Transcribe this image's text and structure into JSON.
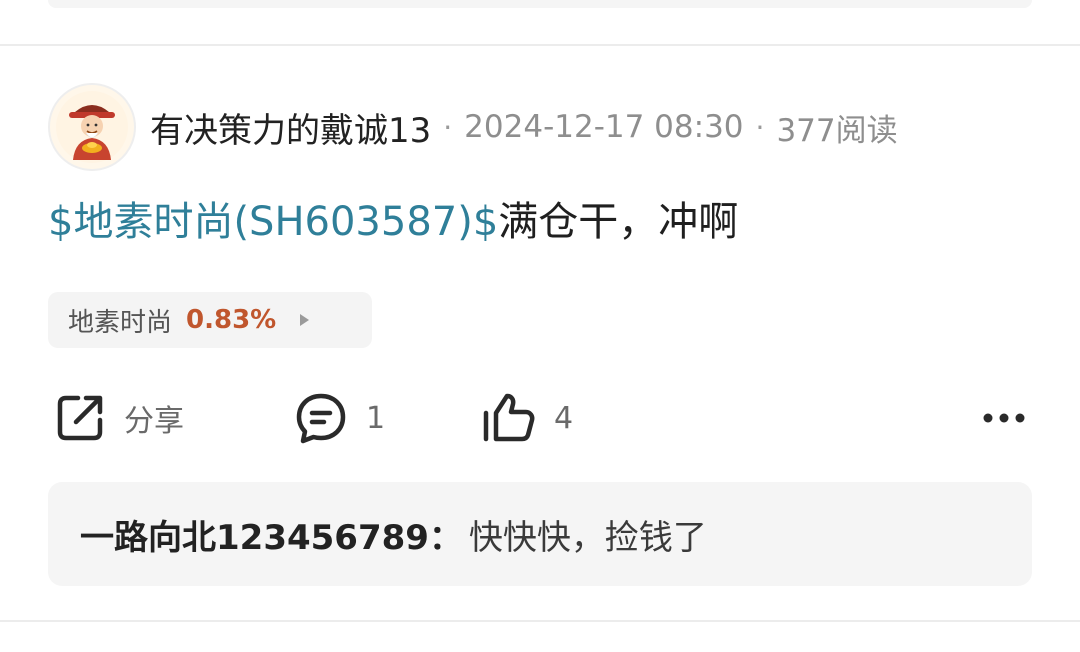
{
  "post": {
    "author": "有决策力的戴诚13",
    "date": "2024-12-17 08:30",
    "views": "377阅读",
    "meta_separator": "·",
    "content": {
      "stock_tag": "$地素时尚(SH603587)$",
      "text": "满仓干，冲啊"
    },
    "stock_chip": {
      "name": "地素时尚",
      "change": "0.83%"
    },
    "actions": {
      "share_label": "分享",
      "comment_count": "1",
      "like_count": "4"
    },
    "reply": {
      "user": "一路向北123456789",
      "colon": "：",
      "text": "快快快，捡钱了"
    }
  },
  "colors": {
    "stock_link": "#2f7f99",
    "change_positive": "#c0562d",
    "reply_bg": "#f5f5f5"
  },
  "icons": {
    "avatar": "avatar-image",
    "share": "share-icon",
    "comment": "comment-icon",
    "like": "thumbs-up-icon",
    "more": "more-icon",
    "chip_arrow": "chevron-right-icon"
  }
}
